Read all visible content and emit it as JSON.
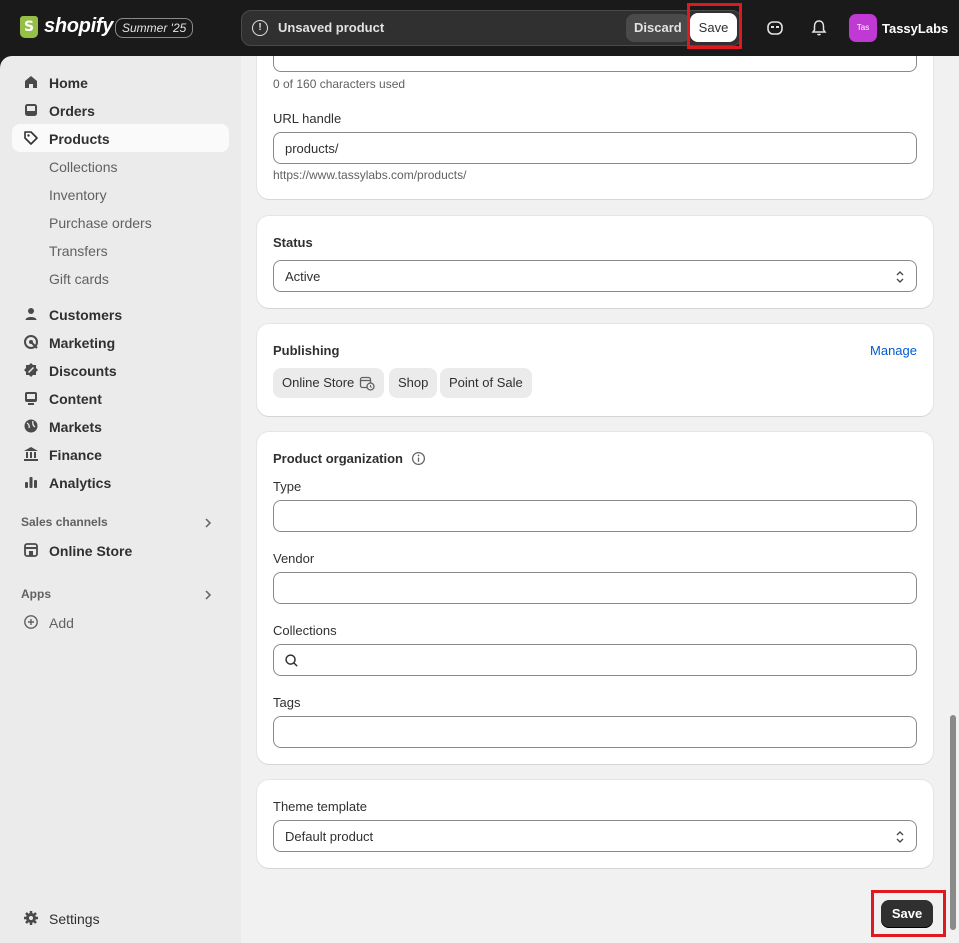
{
  "topbar": {
    "brand": "shopify",
    "edition_badge": "Summer '25",
    "unsaved_message": "Unsaved product",
    "discard_label": "Discard",
    "save_label": "Save",
    "user_initials": "Tas",
    "user_name": "TassyLabs",
    "avatar_color": "#c139d4"
  },
  "sidebar": {
    "items": [
      {
        "label": "Home",
        "icon": "home-icon"
      },
      {
        "label": "Orders",
        "icon": "inbox-icon"
      },
      {
        "label": "Products",
        "icon": "tag-icon",
        "active": true
      }
    ],
    "product_sub_items": [
      "Collections",
      "Inventory",
      "Purchase orders",
      "Transfers",
      "Gift cards"
    ],
    "more_items": [
      {
        "label": "Customers",
        "icon": "person-icon"
      },
      {
        "label": "Marketing",
        "icon": "target-icon"
      },
      {
        "label": "Discounts",
        "icon": "discount-icon"
      },
      {
        "label": "Content",
        "icon": "content-icon"
      },
      {
        "label": "Markets",
        "icon": "globe-icon"
      },
      {
        "label": "Finance",
        "icon": "bank-icon"
      },
      {
        "label": "Analytics",
        "icon": "bar-chart-icon"
      }
    ],
    "sales_channels_title": "Sales channels",
    "online_store_label": "Online Store",
    "apps_title": "Apps",
    "add_label": "Add",
    "settings_label": "Settings"
  },
  "main": {
    "seo": {
      "char_count": "0 of 160 characters used",
      "url_handle_label": "URL handle",
      "url_handle_value": "products/",
      "url_preview": "https://www.tassylabs.com/products/"
    },
    "status": {
      "label": "Status",
      "value": "Active"
    },
    "publishing": {
      "title": "Publishing",
      "manage_label": "Manage",
      "channels": [
        "Online Store",
        "Shop",
        "Point of Sale"
      ]
    },
    "organization": {
      "title": "Product organization",
      "type_label": "Type",
      "vendor_label": "Vendor",
      "collections_label": "Collections",
      "tags_label": "Tags"
    },
    "theme": {
      "label": "Theme template",
      "value": "Default product"
    },
    "save_label": "Save"
  },
  "colors": {
    "highlight": "#e0181f",
    "link": "#005bd3"
  }
}
